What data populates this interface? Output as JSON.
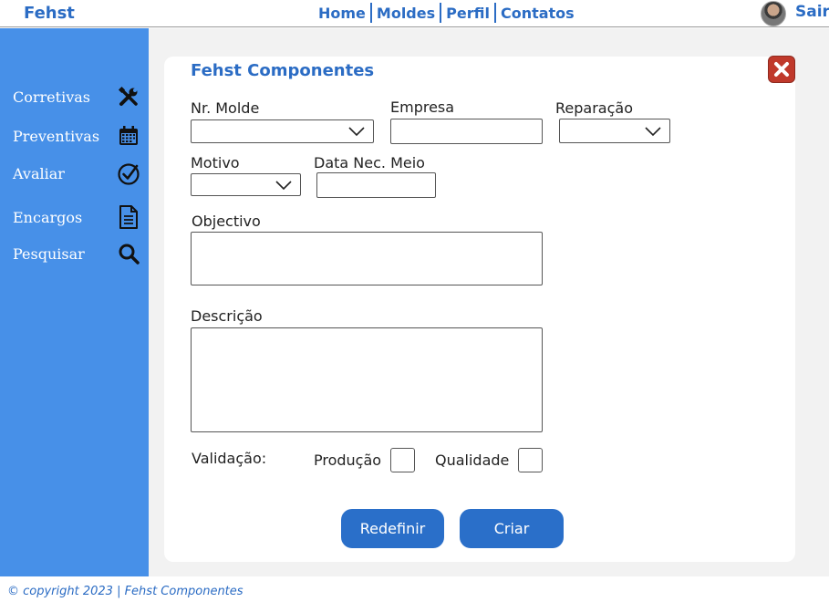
{
  "header": {
    "brand": "Fehst",
    "nav": [
      "Home",
      "Moldes",
      "Perfil",
      "Contatos"
    ],
    "logout": "Sair"
  },
  "sidebar": {
    "items": [
      {
        "label": "Corretivas",
        "icon": "wrench-screwdriver-icon"
      },
      {
        "label": "Preventivas",
        "icon": "calendar-icon"
      },
      {
        "label": "Avaliar",
        "icon": "check-circle-icon"
      },
      {
        "label": "Encargos",
        "icon": "document-icon"
      },
      {
        "label": "Pesquisar",
        "icon": "search-icon"
      }
    ]
  },
  "form": {
    "title": "Fehst Componentes",
    "nr_molde_label": "Nr. Molde",
    "empresa_label": "Empresa",
    "reparacao_label": "Reparação",
    "motivo_label": "Motivo",
    "data_label": "Data Nec. Meio",
    "objectivo_label": "Objectivo",
    "descricao_label": "Descrição",
    "validacao_label": "Validação:",
    "producao_label": "Produção",
    "qualidade_label": "Qualidade",
    "reset_label": "Redefinir",
    "submit_label": "Criar"
  },
  "footer": {
    "text": "© copyright 2023 | Fehst Componentes"
  },
  "colors": {
    "accent": "#2b6cc4",
    "sidebar": "#4790e8",
    "button": "#2a6fc9",
    "close": "#c0392b"
  }
}
